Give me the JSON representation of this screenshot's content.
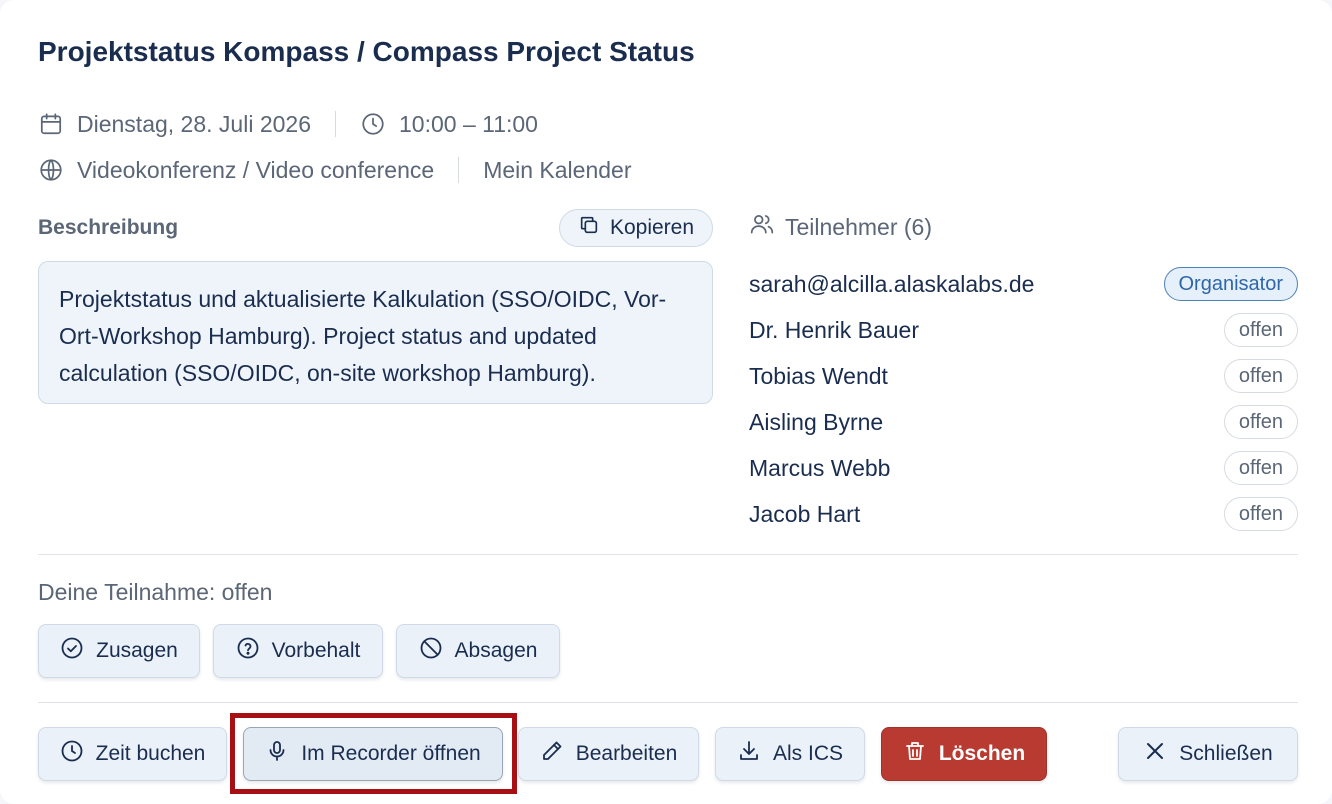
{
  "event": {
    "title": "Projektstatus Kompass / Compass Project Status",
    "date": "Dienstag, 28. Juli 2026",
    "time": "10:00 – 11:00",
    "location": "Videokonferenz / Video conference",
    "calendar": "Mein Kalender"
  },
  "description": {
    "label": "Beschreibung",
    "copy_label": "Kopieren",
    "text": "Projektstatus und aktualisierte Kalkulation (SSO/OIDC, Vor-Ort-Workshop Hamburg). Project status and updated calculation (SSO/OIDC, on-site workshop Hamburg)."
  },
  "participants": {
    "header": "Teilnehmer (6)",
    "items": [
      {
        "name": "sarah@alcilla.alaskalabs.de",
        "status": "Organisator"
      },
      {
        "name": "Dr. Henrik Bauer",
        "status": "offen"
      },
      {
        "name": "Tobias Wendt",
        "status": "offen"
      },
      {
        "name": "Aisling Byrne",
        "status": "offen"
      },
      {
        "name": "Marcus Webb",
        "status": "offen"
      },
      {
        "name": "Jacob Hart",
        "status": "offen"
      }
    ]
  },
  "rsvp": {
    "label": "Deine Teilnahme: offen",
    "accept": "Zusagen",
    "tentative": "Vorbehalt",
    "decline": "Absagen"
  },
  "actions": {
    "book_time": "Zeit buchen",
    "open_recorder": "Im Recorder öffnen",
    "edit": "Bearbeiten",
    "ics": "Als ICS",
    "delete": "Löschen",
    "close": "Schließen"
  },
  "colors": {
    "title": "#1a2d4f",
    "muted": "#5b6676",
    "accent_bg": "#eaf1f8",
    "danger": "#b93a31",
    "highlight": "#a60f14",
    "organizer_badge": "#2f66a8"
  }
}
